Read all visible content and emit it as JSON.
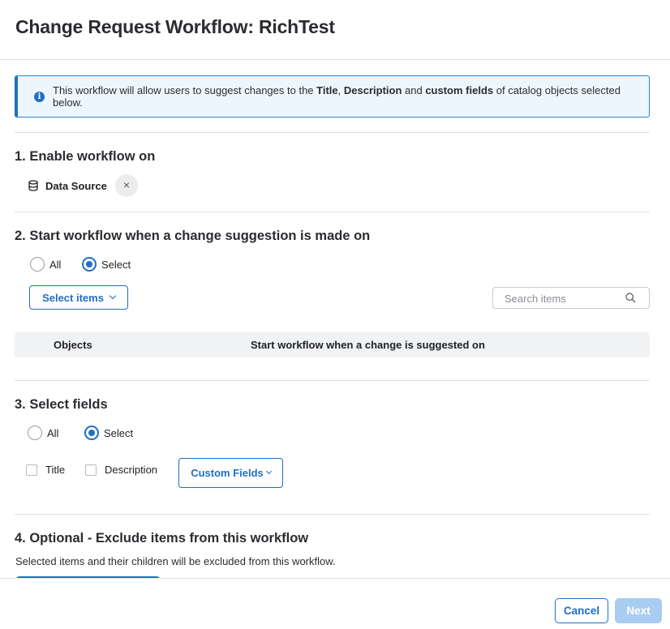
{
  "dialog": {
    "title": "Change Request Workflow: RichTest"
  },
  "info": {
    "text_1": "This workflow will allow users to suggest changes to the ",
    "title_word": "Title",
    "sep_1": ", ",
    "description_word": "Description",
    "sep_2": " and ",
    "custom_fields_word": "custom fields",
    "text_2": " of catalog objects selected below.",
    "icon": "info-icon"
  },
  "section1": {
    "title": "1. Enable workflow on",
    "chip_label": "Data Source",
    "chip_icon": "database-icon",
    "chip_close": "×"
  },
  "section2": {
    "title": "2. Start workflow when a change suggestion is made on",
    "radio_all": "All",
    "radio_select": "Select",
    "selected": "Select",
    "select_items_label": "Select items",
    "search_placeholder": "Search items",
    "table": {
      "col_objects": "Objects",
      "col_start": "Start workflow when a change is suggested on"
    }
  },
  "section3": {
    "title": "3. Select fields",
    "radio_all": "All",
    "radio_select": "Select",
    "selected": "Select",
    "checkbox_title": "Title",
    "checkbox_description": "Description",
    "custom_fields_label": "Custom Fields"
  },
  "section4": {
    "title": "4. Optional - Exclude items from this workflow",
    "description": "Selected items and their children will be excluded from this workflow."
  },
  "footer": {
    "cancel_label": "Cancel",
    "next_label": "Next"
  },
  "colors": {
    "accent": "#1f6fc4",
    "info_bg": "#eef6fd",
    "next_disabled": "#a9cdf0"
  }
}
